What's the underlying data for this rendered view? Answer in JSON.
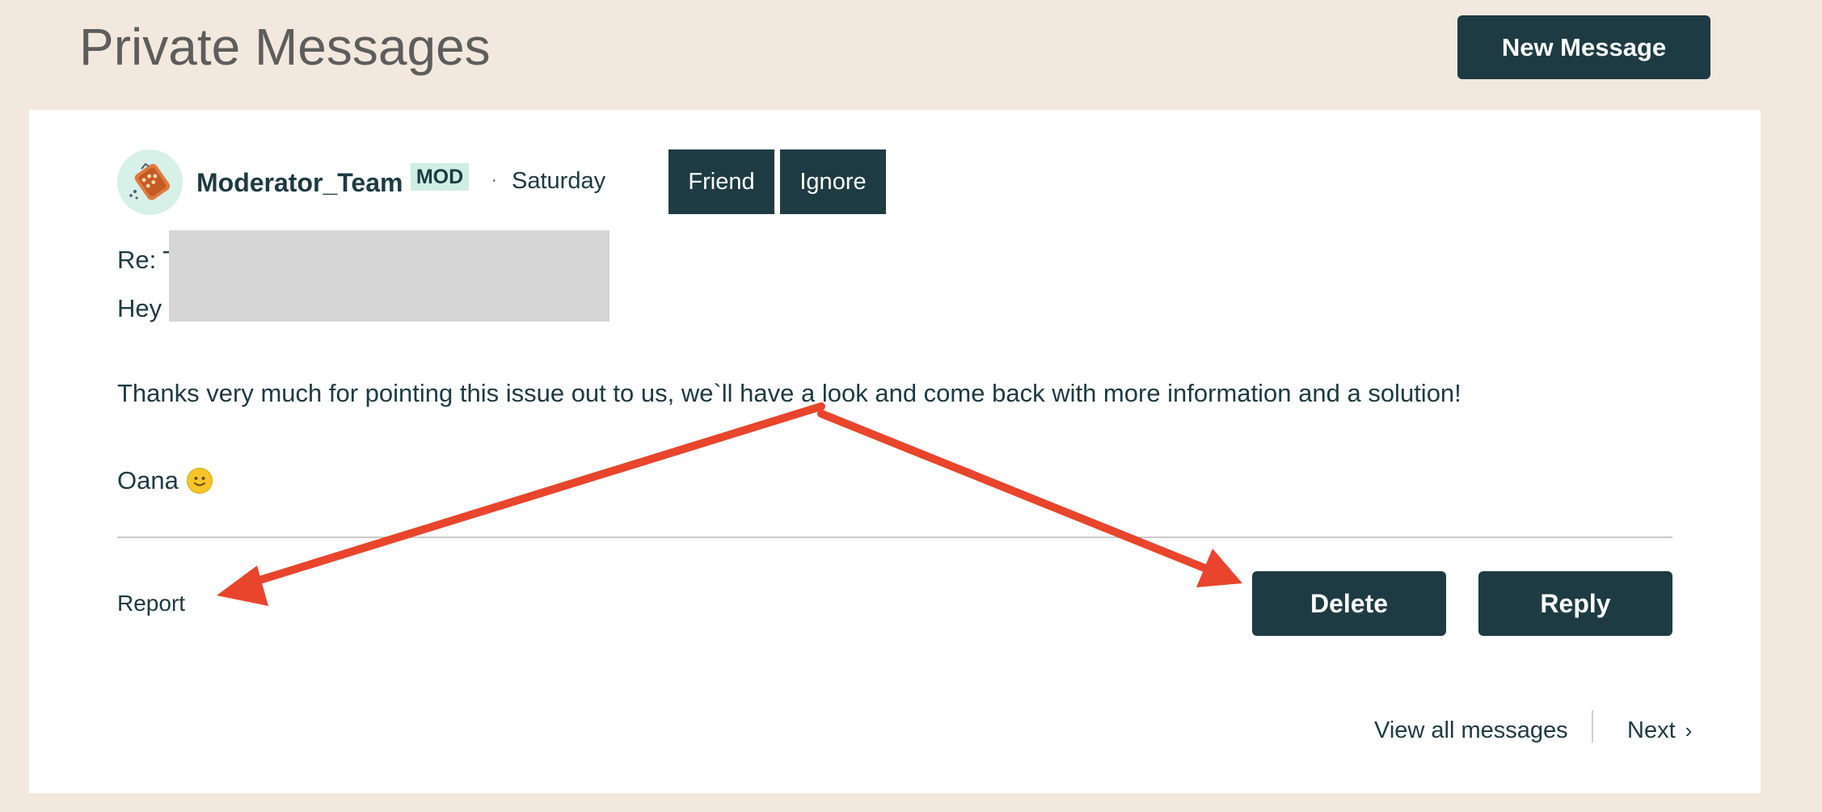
{
  "header": {
    "title": "Private Messages",
    "new_message_label": "New Message"
  },
  "message": {
    "author": "Moderator_Team",
    "badge": "MOD",
    "separator": "·",
    "date": "Saturday",
    "friend_label": "Friend",
    "ignore_label": "Ignore",
    "subject": "Re: T",
    "greeting": "Hey",
    "body": "Thanks very much for pointing this issue out to us, we`ll have a look and come back with more information and a solution!",
    "signoff": "Oana",
    "signoff_emoji": "slightly-smiling-face-icon"
  },
  "actions": {
    "report_label": "Report",
    "delete_label": "Delete",
    "reply_label": "Reply"
  },
  "pager": {
    "view_all_label": "View all messages",
    "next_label": "Next",
    "next_icon": "chevron-right-icon"
  },
  "colors": {
    "page_background": "#f2e8dd",
    "button": "#1e3b43",
    "badge": "#cfeee4",
    "annotation_arrow": "#e8452c",
    "redaction": "#d6d6d6"
  }
}
